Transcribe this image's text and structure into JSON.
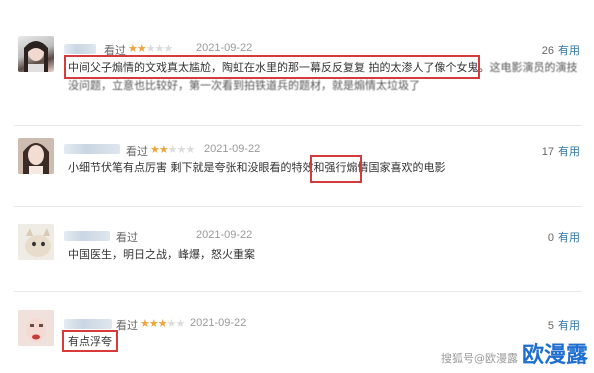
{
  "reviews": [
    {
      "status": "看过",
      "stars": [
        1,
        1,
        0,
        0,
        0
      ],
      "date": "2021-09-22",
      "votes": "26",
      "useful_label": "有用",
      "line1_highlight": "中间父子煽情的文戏真太尴尬，陶虹在水里的那一幕反反复复 拍的太渗人了像个女鬼。",
      "line1_tail": "这电影演员的演技",
      "line2": "没问题，立意也比较好，第一次看到拍铁道兵的题材，就是煽情太垃圾了"
    },
    {
      "status": "看过",
      "stars": [
        1,
        1,
        0,
        0,
        0
      ],
      "date": "2021-09-22",
      "votes": "17",
      "useful_label": "有用",
      "text_before": "小细节伏笔有点厉害 剩下就是夸张和没眼看的特效和",
      "text_highlight": "强行煽情",
      "text_after": "国家喜欢的电影"
    },
    {
      "status": "看过",
      "stars": [
        0,
        0,
        0,
        0,
        0
      ],
      "date": "2021-09-22",
      "votes": "0",
      "useful_label": "有用",
      "text": "中国医生，明日之战，峰爆，怒火重案"
    },
    {
      "status": "看过",
      "stars": [
        1,
        1,
        1,
        0,
        0
      ],
      "date": "2021-09-22",
      "votes": "5",
      "useful_label": "有用",
      "text_highlight": "有点浮夸"
    }
  ],
  "watermark": {
    "source": "搜狐号@欧漫露",
    "brand": "欧漫露"
  },
  "colors": {
    "star_on": "#f0a33a",
    "star_off": "#dcdcdc",
    "highlight_box": "#d63a3a",
    "link_blue": "#3377aa",
    "brand_blue": "#1f6fd0"
  }
}
